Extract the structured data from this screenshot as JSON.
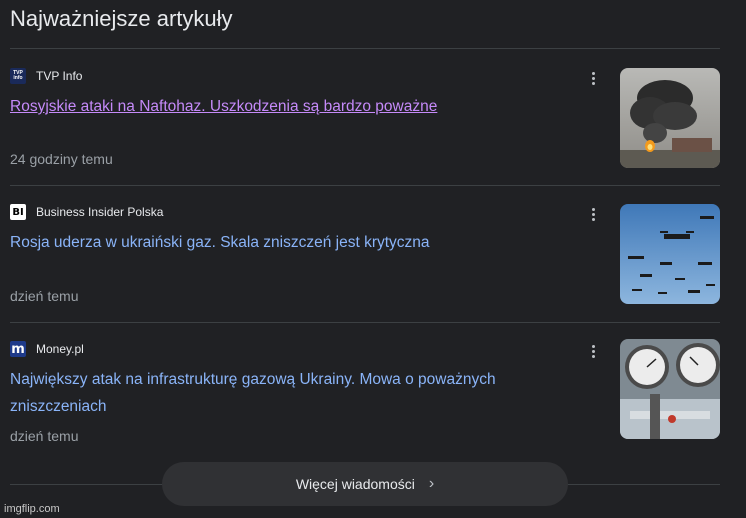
{
  "section": {
    "title": "Najważniejsze artykuły"
  },
  "articles": [
    {
      "source": "TVP Info",
      "logo_text": "TVP info",
      "headline": "Rosyjskie ataki na Naftohaz. Uszkodzenia są bardzo poważne",
      "time": "24 godziny temu",
      "visited": true,
      "thumbnail_icon": "smoke-fire-image"
    },
    {
      "source": "Business Insider Polska",
      "logo_text": "BI",
      "headline": "Rosja uderza w ukraiński gaz. Skala zniszczeń jest krytyczna",
      "time": "dzień temu",
      "visited": false,
      "thumbnail_icon": "drones-image"
    },
    {
      "source": "Money.pl",
      "logo_text": "m",
      "headline": "Największy atak na infrastrukturę gazową Ukrainy. Mowa o poważnych zniszczeniach",
      "time": "dzień temu",
      "visited": false,
      "thumbnail_icon": "pressure-gauges-image"
    }
  ],
  "footer": {
    "more_label": "Więcej wiadomości",
    "watermark": "imgflip.com"
  },
  "colors": {
    "background": "#202124",
    "link": "#8ab4f8",
    "visited_link": "#c58af9",
    "muted": "#9aa0a6"
  }
}
